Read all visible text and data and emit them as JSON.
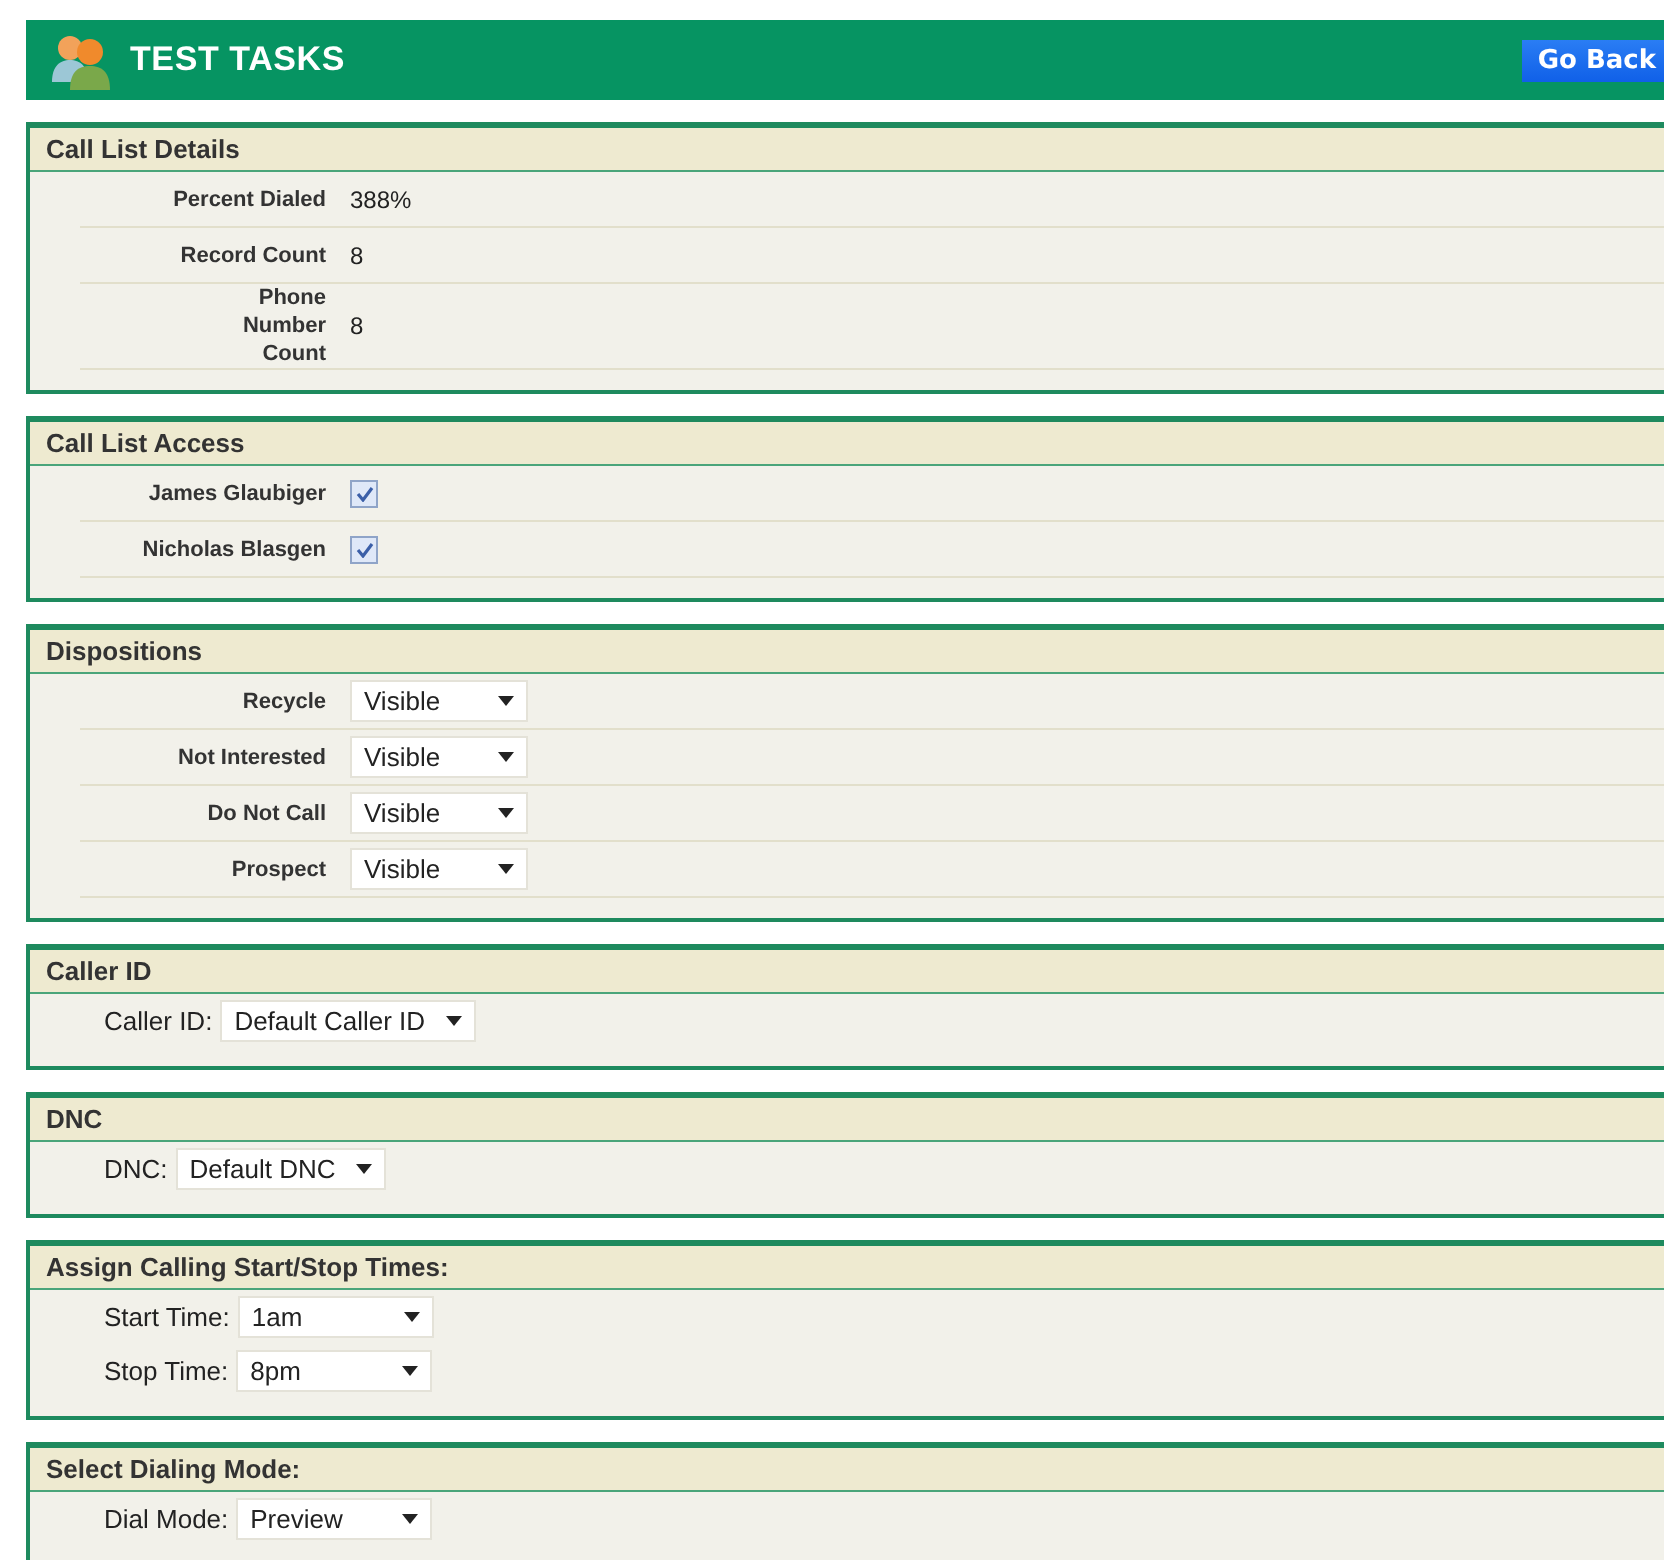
{
  "header": {
    "title": "TEST TASKS",
    "back_button": "Go Back"
  },
  "sections": [
    {
      "kind": "details",
      "title": "Call List Details",
      "rows": [
        {
          "label": "Percent Dialed",
          "value": "388%"
        },
        {
          "label": "Record Count",
          "value": "8"
        },
        {
          "label": "Phone Number Count",
          "value": "8",
          "kind": "wrap"
        }
      ]
    },
    {
      "kind": "access",
      "title": "Call List Access",
      "rows": [
        {
          "label": "James Glaubiger",
          "checked": true
        },
        {
          "label": "Nicholas Blasgen",
          "checked": true
        }
      ]
    },
    {
      "kind": "selects",
      "title": "Dispositions",
      "rows": [
        {
          "label": "Recycle",
          "value": "Visible"
        },
        {
          "label": "Not Interested",
          "value": "Visible"
        },
        {
          "label": "Do Not Call",
          "value": "Visible"
        },
        {
          "label": "Prospect",
          "value": "Visible"
        }
      ]
    },
    {
      "kind": "inline",
      "title": "Caller ID",
      "rows": [
        {
          "label": "Caller ID:",
          "value": "Default Caller ID"
        }
      ]
    },
    {
      "kind": "inline",
      "title": "DNC",
      "rows": [
        {
          "label": "DNC:",
          "value": "Default DNC"
        }
      ]
    },
    {
      "kind": "inline",
      "title": "Assign Calling Start/Stop Times:",
      "rows": [
        {
          "label": "Start Time:",
          "value": "1am"
        },
        {
          "label": "Stop Time:",
          "value": "8pm"
        }
      ]
    },
    {
      "kind": "inline",
      "title": "Select Dialing Mode:",
      "rows": [
        {
          "label": "Dial Mode:",
          "value": "Preview"
        }
      ]
    }
  ]
}
